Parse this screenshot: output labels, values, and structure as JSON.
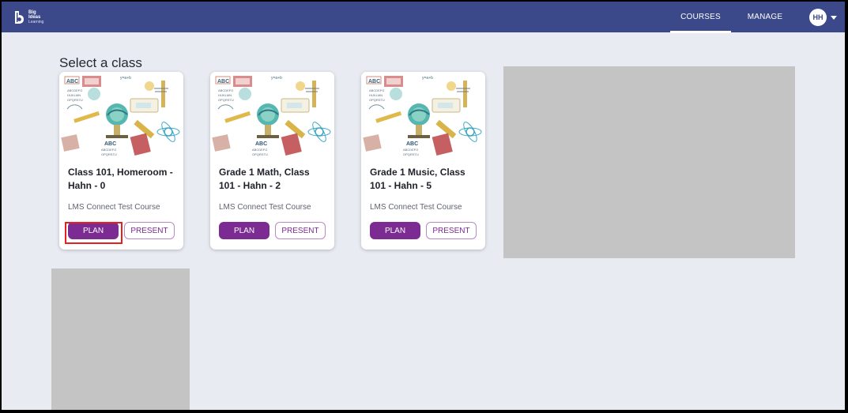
{
  "brand": {
    "name_line_1": "Big",
    "name_line_2": "Ideas",
    "name_line_3": "Learning",
    "icon": "big-ideas-logo-icon",
    "colors": {
      "header": "#3b4889",
      "accent": "#7b2b91",
      "background": "#e8ebf2"
    }
  },
  "nav": {
    "courses": "COURSES",
    "manage": "MANAGE"
  },
  "user": {
    "initials": "HH",
    "menu_icon": "chevron-down-icon"
  },
  "page": {
    "title": "Select a class"
  },
  "classes": [
    {
      "title": "Class 101, Homeroom - Hahn - 0",
      "course": "LMS Connect Test Course",
      "plan": "PLAN",
      "present": "PRESENT",
      "image": "school-supplies-illustration"
    },
    {
      "title": "Grade 1 Math, Class 101 - Hahn - 2",
      "course": "LMS Connect Test Course",
      "plan": "PLAN",
      "present": "PRESENT",
      "image": "school-supplies-illustration"
    },
    {
      "title": "Grade 1 Music, Class 101 - Hahn - 5",
      "course": "LMS Connect Test Course",
      "plan": "PLAN",
      "present": "PRESENT",
      "image": "school-supplies-illustration"
    }
  ],
  "illustration": {
    "alphabet_1": "ABC",
    "alphabet_2": "ABCDEFG",
    "alphabet_3": "HIJKLMN",
    "alphabet_4": "OPQRSTU",
    "alphabet_5": "VWXYZ",
    "formula": "y=a+b"
  }
}
